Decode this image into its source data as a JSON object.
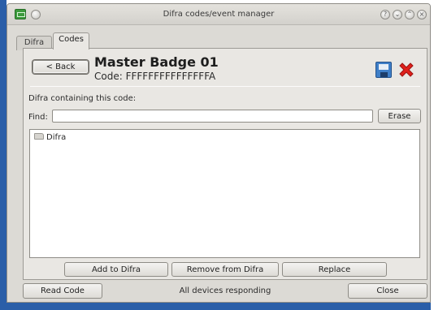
{
  "window": {
    "title": "Difra codes/event manager",
    "controls": {
      "help": "?",
      "minimize": "⌄",
      "maximize": "⌃",
      "close": "×"
    }
  },
  "tabs": [
    {
      "label": "Difra",
      "active": false
    },
    {
      "label": "Codes",
      "active": true
    }
  ],
  "header": {
    "back_label": "< Back",
    "badge_name": "Master Badge 01",
    "code_text": "Code: FFFFFFFFFFFFFFFA"
  },
  "toolbar_icons": [
    "save-icon",
    "delete-icon"
  ],
  "section": {
    "label": "Difra containing this code:",
    "find_label": "Find:",
    "find_value": "",
    "erase_label": "Erase"
  },
  "tree": {
    "items": [
      {
        "label": "Difra",
        "icon": "folder-icon"
      }
    ]
  },
  "actions": {
    "add_label": "Add to Difra",
    "remove_label": "Remove from Difra",
    "replace_label": "Replace"
  },
  "footer": {
    "read_code_label": "Read Code",
    "status": "All devices responding",
    "close_label": "Close"
  },
  "colors": {
    "accent_frame": "#2a5ea8",
    "window_bg": "#dcdad5",
    "panel_bg": "#e9e7e3",
    "delete_red": "#e0201b",
    "save_blue": "#3f7fc8"
  }
}
